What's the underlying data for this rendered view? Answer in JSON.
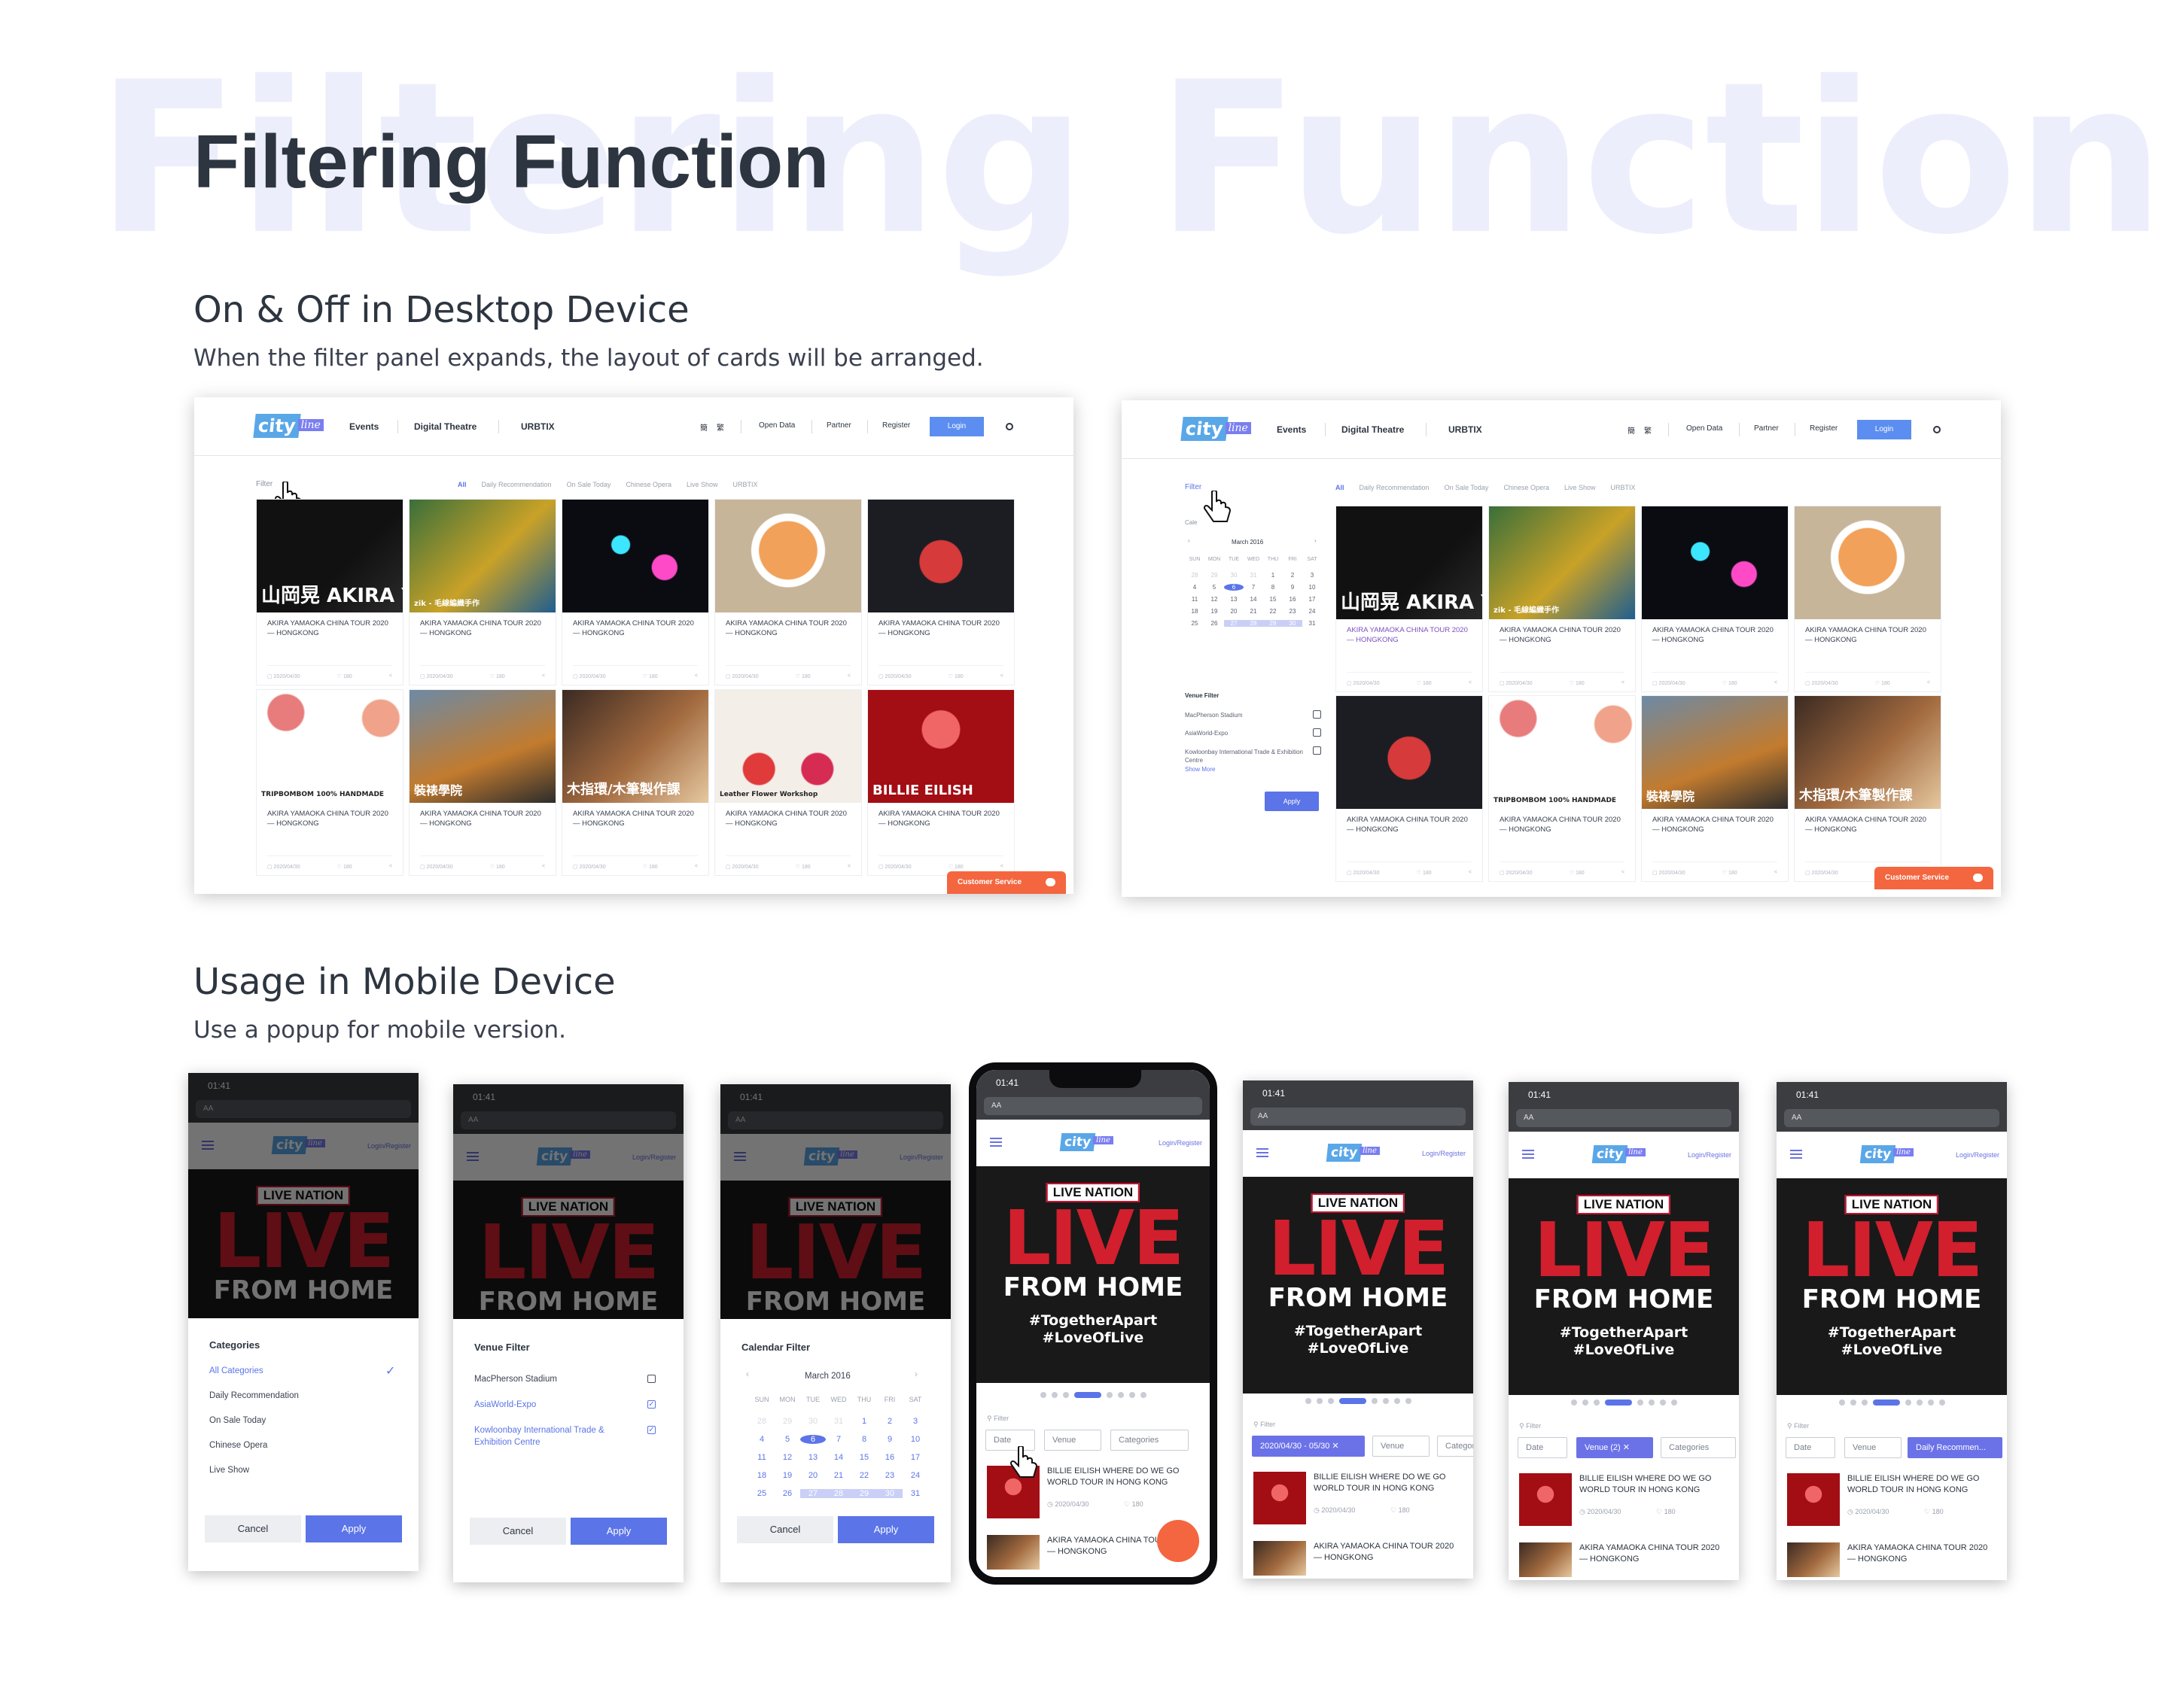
{
  "page": {
    "bg_title": "Filtering Function",
    "title": "Filtering Function",
    "desktop_heading": "On & Off in Desktop Device",
    "desktop_desc": "When the filter panel expands, the layout of cards will be arranged.",
    "mobile_heading": "Usage in Mobile Device",
    "mobile_desc": "Use a popup for mobile version."
  },
  "nav": {
    "logo_city": "city",
    "logo_line": "line",
    "events": "Events",
    "digital_theatre": "Digital Theatre",
    "urbtix": "URBTIX",
    "lang1": "簡",
    "lang2": "繁",
    "open_data": "Open Data",
    "partner": "Partner",
    "register": "Register",
    "login": "Login"
  },
  "listing": {
    "filter": "Filter",
    "tabs": [
      "All",
      "Daily Recommendation",
      "On Sale Today",
      "Chinese Opera",
      "Live Show",
      "URBTIX"
    ],
    "card_title": "AKIRA YAMAOKA CHINA TOUR 2020 — HONGKONG",
    "card_date": "2020/04/30",
    "card_likes": "180",
    "customer_service": "Customer Service",
    "card_img_text": [
      "山岡晃 AKIRA YAMAOKA",
      "zik - 毛線編織手作",
      "",
      "",
      "",
      "TRIPBOMBOM 100% HANDMADE",
      "裝裱學院",
      "木指環/木筆製作課",
      "Leather Flower Workshop",
      "BILLIE EILISH"
    ]
  },
  "side_filter": {
    "cal_label": "Cale",
    "month": "March 2016",
    "weekdays": [
      "SUN",
      "MON",
      "TUE",
      "WED",
      "THU",
      "FRI",
      "SAT"
    ],
    "days": [
      "28",
      "29",
      "30",
      "31",
      "1",
      "2",
      "3",
      "4",
      "5",
      "6",
      "7",
      "8",
      "9",
      "10",
      "11",
      "12",
      "13",
      "14",
      "15",
      "16",
      "17",
      "18",
      "19",
      "20",
      "21",
      "22",
      "23",
      "24",
      "25",
      "26",
      "27",
      "28",
      "29",
      "30",
      "31"
    ],
    "venue_title": "Venue Filter",
    "venues": [
      "MacPherson Stadium",
      "AsiaWorld-Expo",
      "Kowloonbay International Trade & Exhibition Centre"
    ],
    "show_more": "Show More",
    "apply": "Apply"
  },
  "mobile": {
    "time": "01:41",
    "url_aa": "AA",
    "login_register": "Login/Register",
    "live_nation": "LIVE NATION",
    "live": "LIVE",
    "from_home": "FROM HOME",
    "tag1": "#TogetherApart",
    "tag2": "#LoveOfLive",
    "categories_title": "Categories",
    "categories": [
      "All Categories",
      "Daily Recommendation",
      "On Sale Today",
      "Chinese Opera",
      "Live Show"
    ],
    "venue_title": "Venue Filter",
    "venues": [
      "MacPherson Stadium",
      "AsiaWorld-Expo",
      "Kowloonbay International Trade & Exhibition Centre"
    ],
    "calendar_title": "Calendar Filter",
    "month": "March 2016",
    "cancel": "Cancel",
    "apply": "Apply",
    "filter": "Filter",
    "chip_date": "Date",
    "chip_venue": "Venue",
    "chip_categories": "Categories",
    "chip_date_range": "2020/04/30 - 05/30",
    "chip_venue_count": "2",
    "chip_daily": "Daily Recommen...",
    "event1": "BILLIE EILISH WHERE DO WE GO WORLD TOUR IN HONG KONG",
    "event2": "AKIRA YAMAOKA CHINA TOUR 2020 — HONGKONG",
    "event_date": "2020/04/30",
    "event_likes": "180"
  },
  "colors": {
    "accent": "#5b74e8",
    "brand_blue": "#5aa7e8",
    "live_red": "#d11f2d",
    "cs_orange": "#f4663f"
  }
}
